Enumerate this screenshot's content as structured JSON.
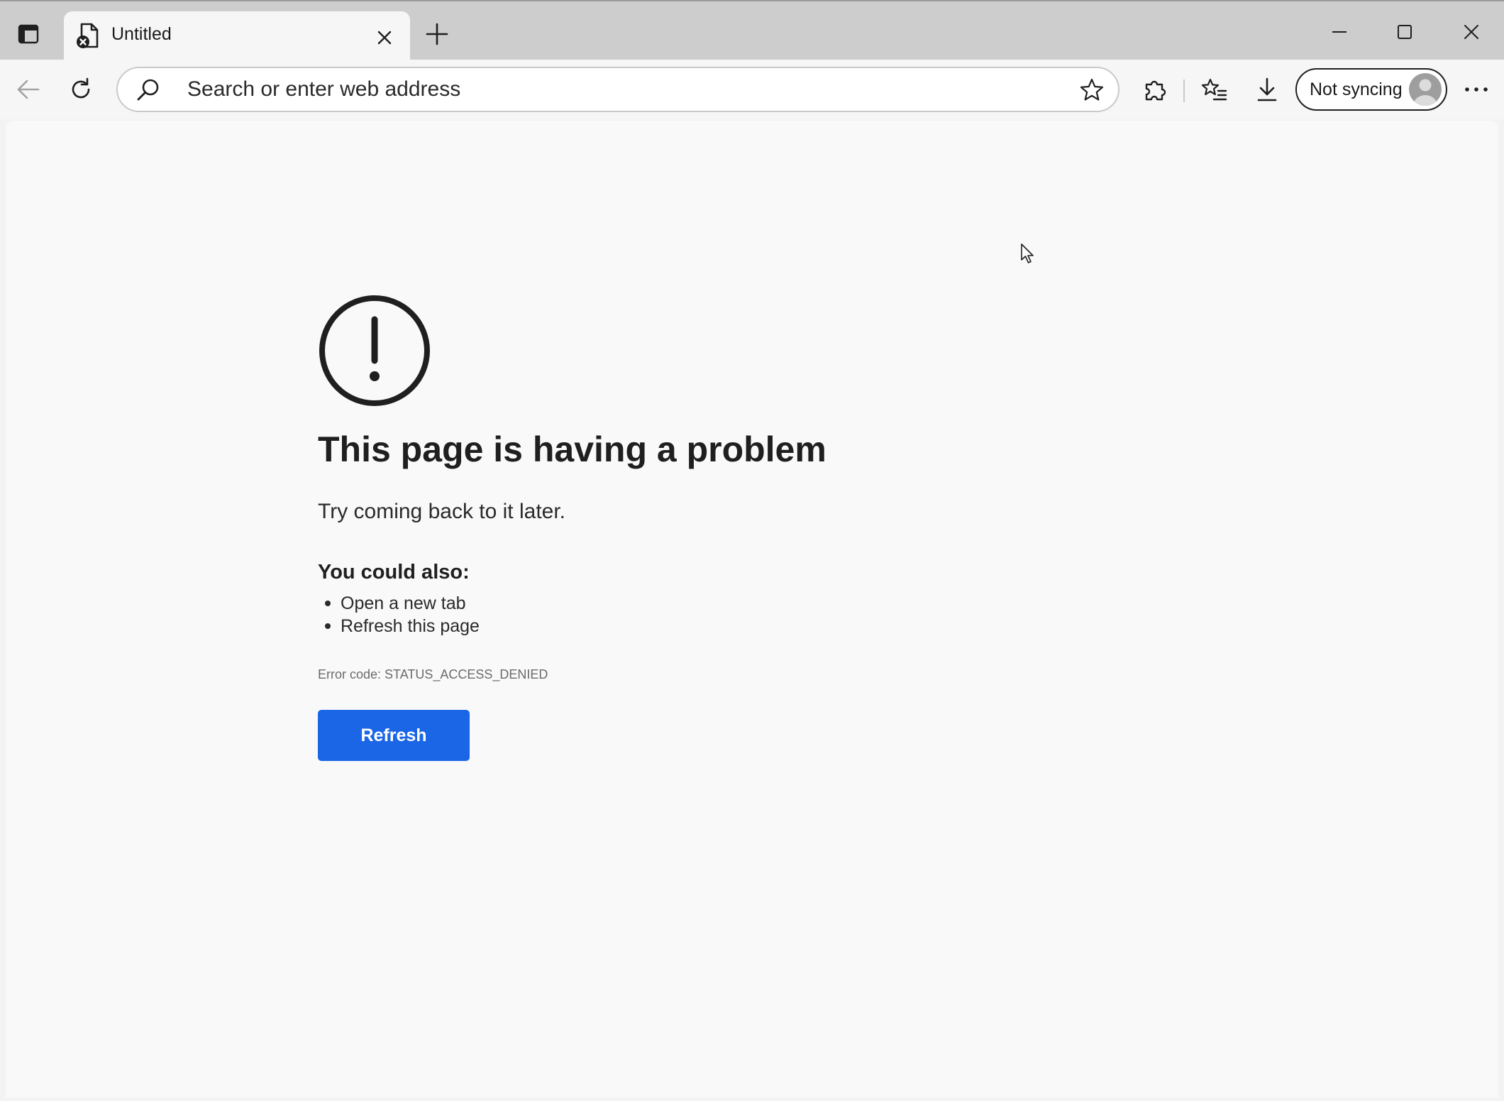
{
  "tabstrip": {
    "active_tab_title": "Untitled"
  },
  "toolbar": {
    "address_placeholder": "Search or enter web address",
    "address_value": "",
    "profile_label": "Not syncing"
  },
  "error_page": {
    "title": "This page is having a problem",
    "subtitle": "Try coming back to it later.",
    "suggestions_heading": "You could also:",
    "suggestions": [
      "Open a new tab",
      "Refresh this page"
    ],
    "error_code": "Error code: STATUS_ACCESS_DENIED",
    "refresh_label": "Refresh"
  },
  "icons": {
    "tab_actions": "tab-actions-icon",
    "favicon": "page-error-icon",
    "close_tab": "close-icon",
    "new_tab": "plus-icon",
    "minimize": "minimize-icon",
    "maximize": "maximize-icon",
    "close_window": "close-icon",
    "back": "back-arrow-icon",
    "reload": "reload-icon",
    "search": "search-icon",
    "favorite": "star-icon",
    "extensions": "puzzle-icon",
    "favorites": "favorites-list-icon",
    "downloads": "download-icon",
    "more": "more-dots-icon",
    "error": "exclamation-circle-icon"
  },
  "colors": {
    "accent_button": "#1a66e6",
    "tabstrip_bg": "#cdcdcd",
    "page_bg": "#f9f9f9"
  }
}
